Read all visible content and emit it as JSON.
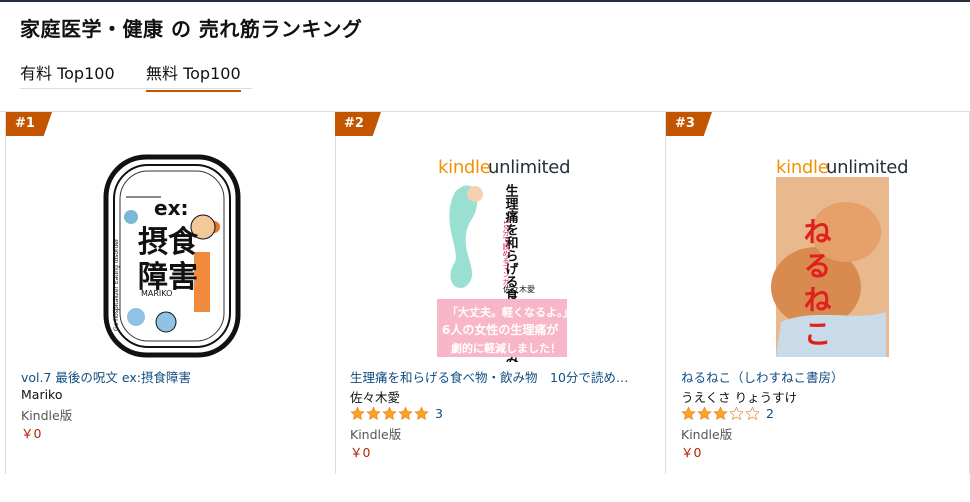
{
  "page": {
    "title": "家庭医学・健康 の 売れ筋ランキング"
  },
  "tabs": [
    {
      "label": "有料 Top100",
      "active": false
    },
    {
      "label": "無料 Top100",
      "active": true
    }
  ],
  "colors": {
    "accent": "#c45500",
    "link": "#0f4c81",
    "price": "#b12704",
    "star": "#ffa41c"
  },
  "items": [
    {
      "rank": "#1",
      "cover_kind": "comic-cover",
      "cover_text": {
        "line1": "ex:",
        "line2": "摂食",
        "line3": "障害",
        "ring": "Go hospitalize! Eating disorder",
        "author_tag": "MARIKO"
      },
      "title": "vol.7 最後の呪文 ex:摂食障害",
      "author": "Mariko",
      "rating": null,
      "review_count": "",
      "format": "Kindle版",
      "price": "￥0"
    },
    {
      "rank": "#2",
      "cover_kind": "kindle-unlimited",
      "ku_logo": {
        "kindle": "kindle",
        "unlimited": "unlimited"
      },
      "cover_text": {
        "title": "生理痛を和らげる食べ物・飲み物",
        "sub": "10分で読めるマンガ",
        "author": "佐々木愛",
        "banner1": "「大丈夫。軽くなるよ。」",
        "banner2": "6人の女性の生理痛が",
        "banner3": "劇的に軽減しました！"
      },
      "title": "生理痛を和らげる食べ物・飲み物　10分で読め…",
      "author": "佐々木愛",
      "rating": 5,
      "review_count": "3",
      "format": "Kindle版",
      "price": "￥0"
    },
    {
      "rank": "#3",
      "cover_kind": "kindle-unlimited",
      "ku_logo": {
        "kindle": "kindle",
        "unlimited": "unlimited"
      },
      "cover_text": {
        "title": "ねるねこ"
      },
      "title": "ねるねこ（しわすねこ書房）",
      "author": "うえくさ りょうすけ",
      "rating": 3,
      "review_count": "2",
      "format": "Kindle版",
      "price": "￥0"
    }
  ]
}
